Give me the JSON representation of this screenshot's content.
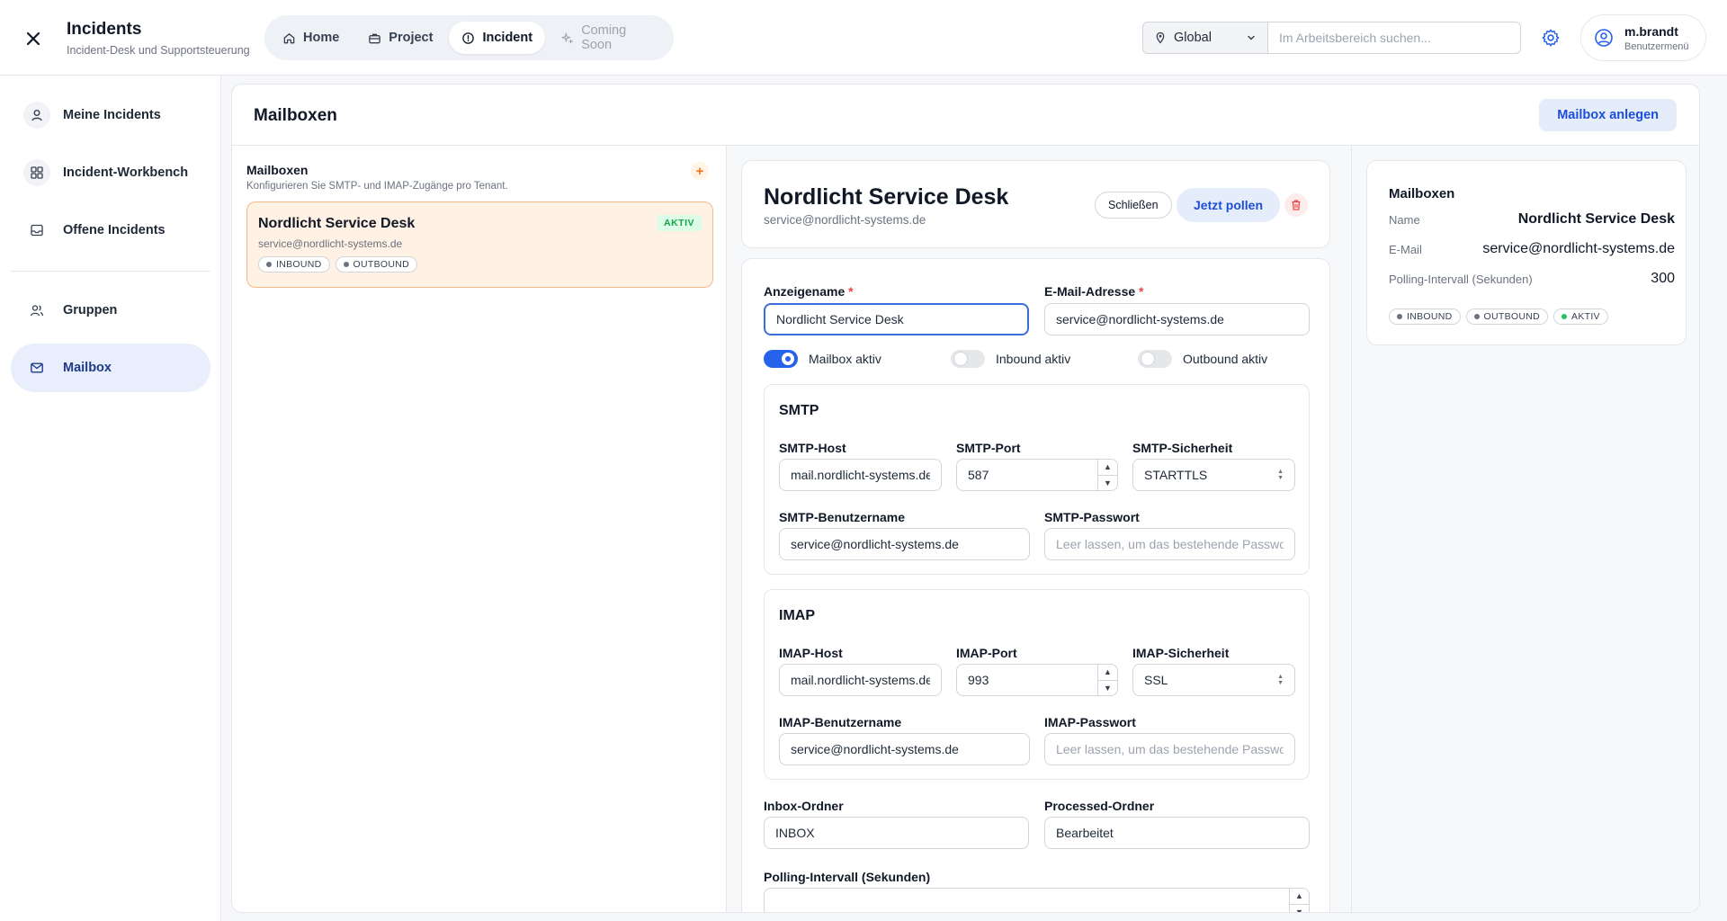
{
  "header": {
    "app_title": "Incidents",
    "app_subtitle": "Incident-Desk und Supportsteuerung",
    "tabs": [
      {
        "label": "Home",
        "icon": "home-icon"
      },
      {
        "label": "Project",
        "icon": "briefcase-icon"
      },
      {
        "label": "Incident",
        "icon": "info-circle-icon"
      },
      {
        "label": "Coming Soon",
        "icon": "sparkle-icon"
      }
    ],
    "scope": "Global",
    "search_placeholder": "Im Arbeitsbereich suchen...",
    "user_name": "m.brandt",
    "user_menu_label": "Benutzermenü"
  },
  "sidebar": {
    "items": [
      {
        "label": "Meine Incidents",
        "icon": "user-icon"
      },
      {
        "label": "Incident-Workbench",
        "icon": "grid-icon"
      },
      {
        "label": "Offene Incidents",
        "icon": "inbox-icon"
      },
      {
        "label": "Gruppen",
        "icon": "users-icon"
      },
      {
        "label": "Mailbox",
        "icon": "mail-icon"
      }
    ]
  },
  "page": {
    "title": "Mailboxen",
    "create_button": "Mailbox anlegen"
  },
  "list": {
    "title": "Mailboxen",
    "subtitle": "Konfigurieren Sie SMTP- und IMAP-Zugänge pro Tenant.",
    "add_symbol": "+",
    "items": [
      {
        "name": "Nordlicht Service Desk",
        "email": "service@nordlicht-systems.de",
        "status": "AKTIV",
        "tags": [
          "INBOUND",
          "OUTBOUND"
        ]
      }
    ]
  },
  "detail": {
    "name": "Nordlicht Service Desk",
    "email": "service@nordlicht-systems.de",
    "close_button": "Schließen",
    "poll_button": "Jetzt pollen"
  },
  "form": {
    "display_name_label": "Anzeigename",
    "display_name_value": "Nordlicht Service Desk",
    "email_label": "E-Mail-Adresse",
    "email_value": "service@nordlicht-systems.de",
    "required_marker": "*",
    "toggles": [
      {
        "label": "Mailbox aktiv",
        "on": true
      },
      {
        "label": "Inbound aktiv",
        "on": false
      },
      {
        "label": "Outbound aktiv",
        "on": false
      }
    ],
    "smtp": {
      "title": "SMTP",
      "host_label": "SMTP-Host",
      "host_value": "mail.nordlicht-systems.de",
      "port_label": "SMTP-Port",
      "port_value": "587",
      "security_label": "SMTP-Sicherheit",
      "security_value": "STARTTLS",
      "user_label": "SMTP-Benutzername",
      "user_value": "service@nordlicht-systems.de",
      "password_label": "SMTP-Passwort",
      "password_placeholder": "Leer lassen, um das bestehende Passwort zu behalten"
    },
    "imap": {
      "title": "IMAP",
      "host_label": "IMAP-Host",
      "host_value": "mail.nordlicht-systems.de",
      "port_label": "IMAP-Port",
      "port_value": "993",
      "security_label": "IMAP-Sicherheit",
      "security_value": "SSL",
      "user_label": "IMAP-Benutzername",
      "user_value": "service@nordlicht-systems.de",
      "password_label": "IMAP-Passwort",
      "password_placeholder": "Leer lassen, um das bestehende Passwort zu behalten"
    },
    "inbox_folder_label": "Inbox-Ordner",
    "inbox_folder_value": "INBOX",
    "processed_folder_label": "Processed-Ordner",
    "processed_folder_value": "Bearbeitet",
    "polling_label": "Polling-Intervall (Sekunden)"
  },
  "summary": {
    "title": "Mailboxen",
    "rows": [
      {
        "key": "Name",
        "value": "Nordlicht Service Desk"
      },
      {
        "key": "E-Mail",
        "value": "service@nordlicht-systems.de"
      },
      {
        "key": "Polling-Intervall (Sekunden)",
        "value": "300"
      }
    ],
    "tags": [
      "INBOUND",
      "OUTBOUND",
      "AKTIV"
    ]
  },
  "colors": {
    "accent": "#2563eb",
    "active_card_bg": "#fff1e3",
    "status_green": "#16a34a",
    "danger": "#ef4444"
  }
}
